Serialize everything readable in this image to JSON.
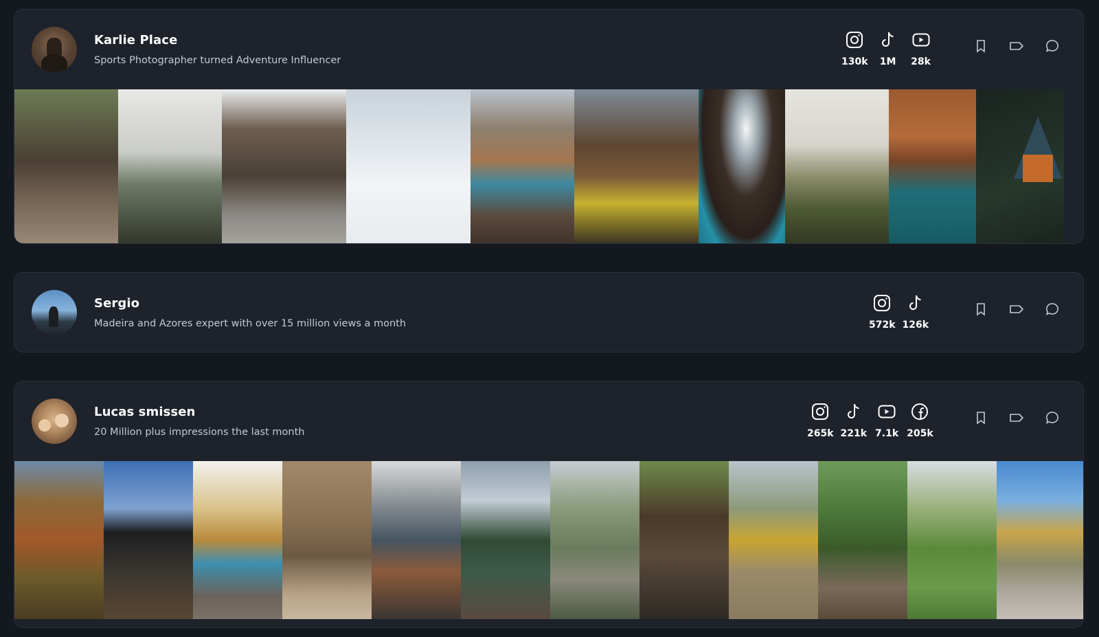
{
  "creators": [
    {
      "name": "Karlie Place",
      "bio": "Sports Photographer turned Adventure Influencer",
      "socials": [
        {
          "icon": "instagram-icon",
          "count": "130k"
        },
        {
          "icon": "tiktok-icon",
          "count": "1M"
        },
        {
          "icon": "youtube-icon",
          "count": "28k"
        }
      ]
    },
    {
      "name": "Sergio",
      "bio": "Madeira and Azores expert with over 15 million views a month",
      "socials": [
        {
          "icon": "instagram-icon",
          "count": "572k"
        },
        {
          "icon": "tiktok-icon",
          "count": "126k"
        }
      ]
    },
    {
      "name": "Lucas smissen",
      "bio": "20 Million plus impressions the last month",
      "socials": [
        {
          "icon": "instagram-icon",
          "count": "265k"
        },
        {
          "icon": "tiktok-icon",
          "count": "221k"
        },
        {
          "icon": "youtube-icon",
          "count": "7.1k"
        },
        {
          "icon": "facebook-icon",
          "count": "205k"
        }
      ]
    }
  ],
  "actions": [
    "bookmark-icon",
    "tag-icon",
    "comment-icon"
  ],
  "colors": {
    "background": "#14181f",
    "card": "#1d222b",
    "text": "#ffffff",
    "muted": "#c6cad1"
  }
}
